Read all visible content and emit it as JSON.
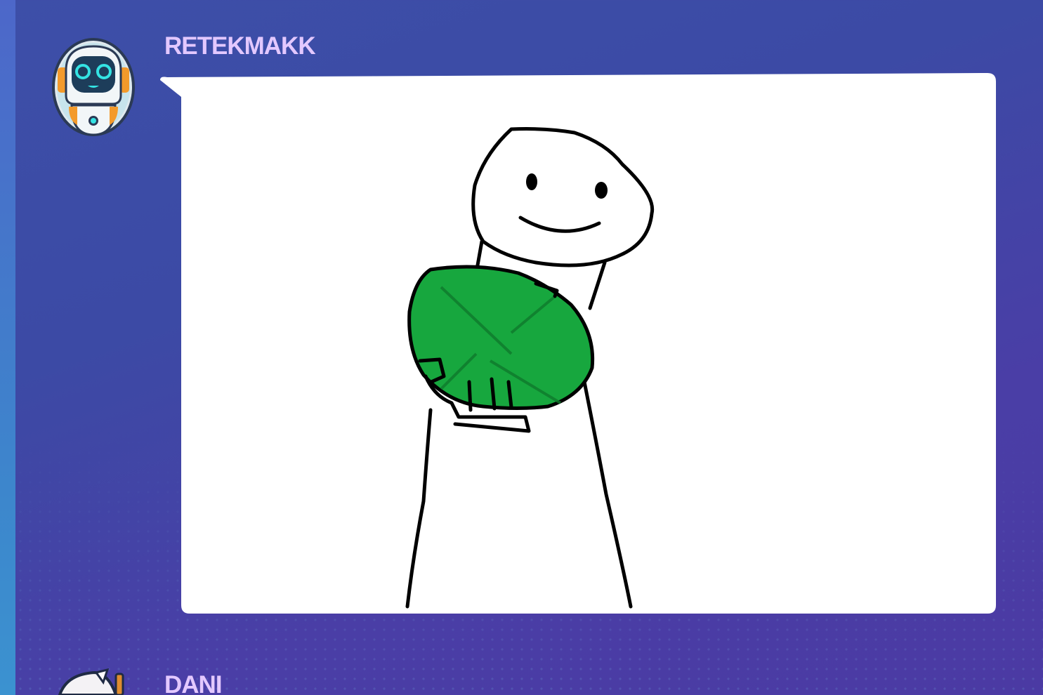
{
  "messages": [
    {
      "username": "RETEKMAKK",
      "username_color": "#e3c8ff",
      "avatar_icon": "robot-avatar-icon",
      "attachment": {
        "type": "drawing",
        "description_icon": "smiling-stick-figure-holding-green-object-icon"
      }
    },
    {
      "username": "DANI",
      "username_color": "#e3c8ff",
      "avatar_icon": "bunny-avatar-icon"
    }
  ],
  "colors": {
    "background": "#3e48a6",
    "accent_strip": "#3b86cc",
    "bubble": "#ffffff",
    "drawing_green": "#17a73e"
  }
}
